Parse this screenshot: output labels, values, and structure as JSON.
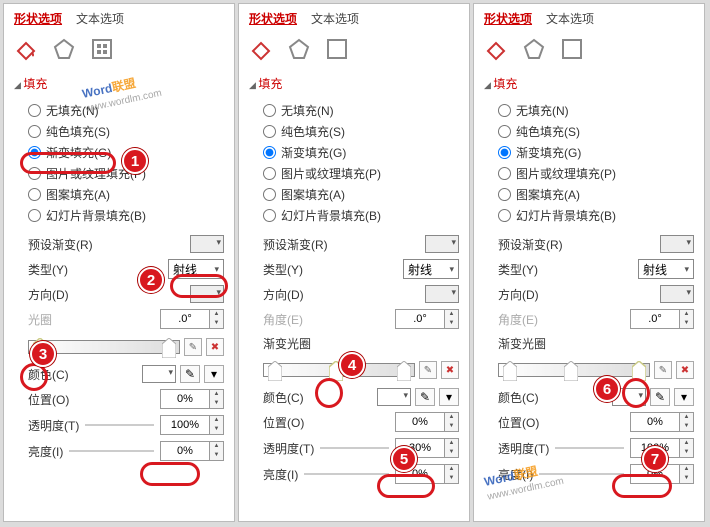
{
  "tabs": {
    "shape": "形状选项",
    "text": "文本选项"
  },
  "section": "填充",
  "fill": {
    "none": "无填充(N)",
    "solid": "纯色填充(S)",
    "grad": "渐变填充(G)",
    "pic": "图片或纹理填充(P)",
    "patt": "图案填充(A)",
    "slide": "幻灯片背景填充(B)"
  },
  "preset": "预设渐变(R)",
  "type": {
    "label": "类型(Y)",
    "value": "射线"
  },
  "dir": "方向(D)",
  "angle": {
    "label": "角度(E)",
    "value": ".0°"
  },
  "gradStops": "渐变光圈",
  "color": "颜色(C)",
  "pos": {
    "label": "位置(O)",
    "value": "0%"
  },
  "trans": {
    "label": "透明度(T)"
  },
  "bright": {
    "label": "亮度(I)",
    "value": "0%"
  },
  "p1": {
    "angleLabel": "光圈",
    "trans": "100%",
    "stopPos": "7%"
  },
  "p2": {
    "trans": "30%",
    "stopPos": "48%"
  },
  "p3": {
    "trans": "100%",
    "stopPos": "93%"
  },
  "badges": {
    "1": "1",
    "2": "2",
    "3": "3",
    "4": "4",
    "5": "5",
    "6": "6",
    "7": "7"
  },
  "wm": {
    "a": "Word",
    "b": "联盟",
    "url": "www.wordlm.com"
  }
}
